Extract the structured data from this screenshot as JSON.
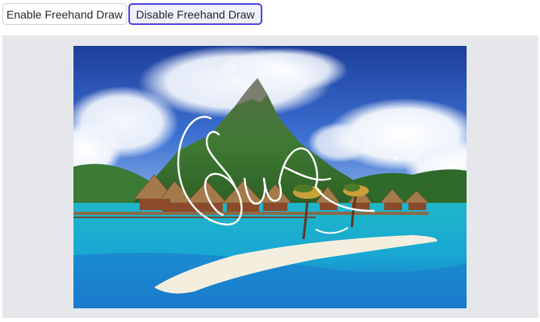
{
  "toolbar": {
    "enable_label": "Enable Freehand Draw",
    "disable_label": "Disable Freehand Draw",
    "active_button": "disable"
  },
  "canvas": {
    "background_color": "#e6e7ea",
    "image_subject": "tropical lagoon with overwater bungalows, mountain and clouds",
    "freehand_stroke_color": "#ffffff"
  },
  "colors": {
    "accent": "#4f46e5"
  }
}
